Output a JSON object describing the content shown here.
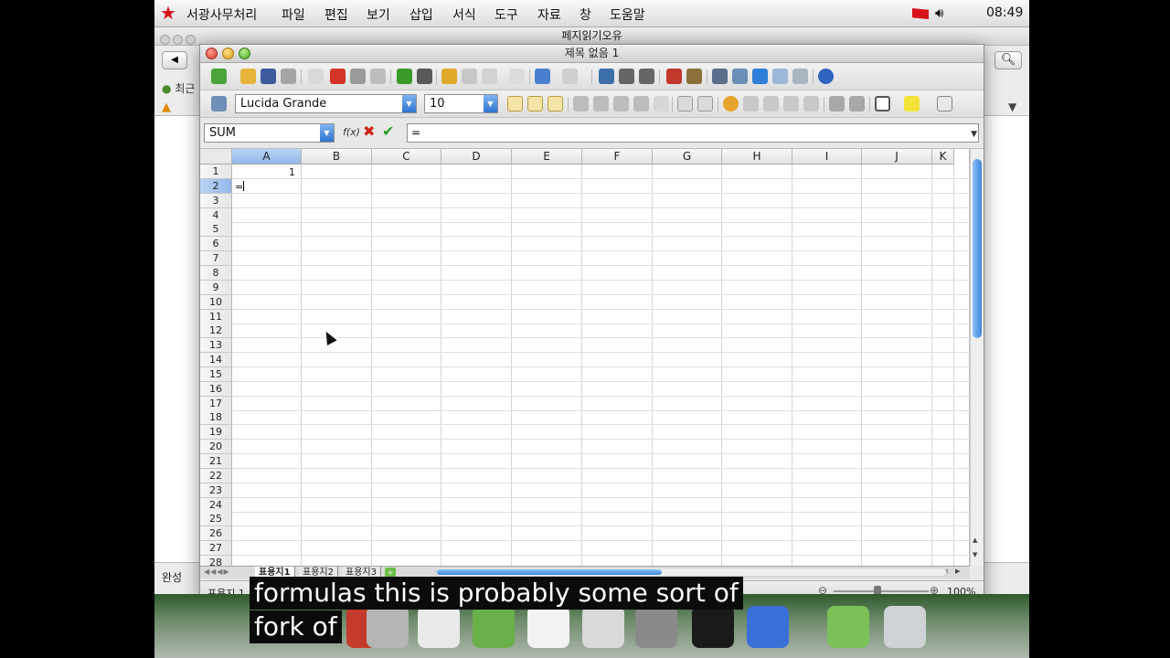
{
  "menubar": {
    "app_name": "서광사무처리",
    "items": [
      "파일",
      "편집",
      "보기",
      "삽입",
      "서식",
      "도구",
      "자료",
      "창",
      "도움말"
    ],
    "clock": "08:49"
  },
  "background_window": {
    "title": "페지읽기오유",
    "bookmark": "최근",
    "status": "완성"
  },
  "calc": {
    "title": "제목 없음 1",
    "font_name": "Lucida Grande",
    "font_size": "10",
    "name_box": "SUM",
    "formula": "=",
    "columns": [
      "A",
      "B",
      "C",
      "D",
      "E",
      "F",
      "G",
      "H",
      "I",
      "J",
      "K"
    ],
    "rows": [
      "1",
      "2",
      "3",
      "4",
      "5",
      "6",
      "7",
      "8",
      "9",
      "10",
      "11",
      "12",
      "13",
      "14",
      "15",
      "16",
      "17",
      "18",
      "19",
      "20",
      "21",
      "22",
      "23",
      "24",
      "25",
      "26",
      "27",
      "28"
    ],
    "cells": {
      "A1": "1",
      "A2": "="
    },
    "sheet_tabs": [
      "표용지1",
      "표용지2",
      "표용지3"
    ],
    "active_sheet": "표용지1",
    "status_left": "표용지 1",
    "zoom": "100%"
  },
  "subtitles": {
    "line1": "formulas this is probably some sort of",
    "line2": "fork of"
  },
  "colors": {
    "accent": "#3d86dc",
    "selected_header": "#93b7e8",
    "star": "#d8121b"
  }
}
